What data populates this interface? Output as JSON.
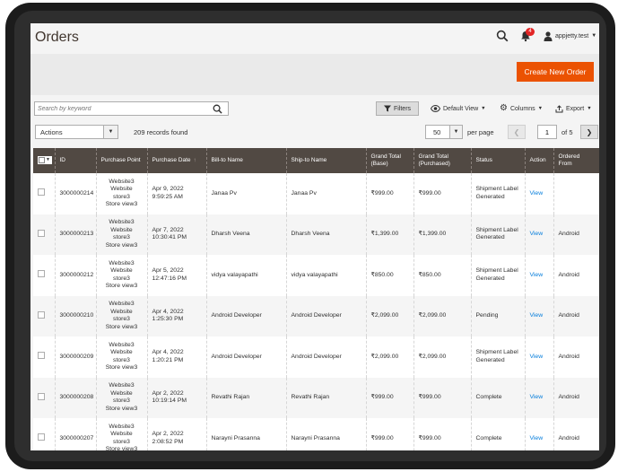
{
  "header": {
    "title": "Orders",
    "user_name": "appjetty.test",
    "notification_count": "4"
  },
  "actions": {
    "create_label": "Create New Order"
  },
  "toolbar": {
    "search_placeholder": "Search by keyword",
    "filters_label": "Filters",
    "default_view_label": "Default View",
    "columns_label": "Columns",
    "export_label": "Export",
    "mass_action_label": "Actions",
    "records_found": "209 records found",
    "per_page_value": "50",
    "per_page_label": "per page",
    "current_page": "1",
    "total_pages_label": "of 5"
  },
  "table": {
    "columns": [
      "ID",
      "Purchase Point",
      "Purchase Date",
      "Bill-to Name",
      "Ship-to Name",
      "Grand Total (Base)",
      "Grand Total (Purchased)",
      "Status",
      "Action",
      "Ordered From"
    ],
    "purchase_point_lines": [
      "Website3",
      "Website",
      "store3",
      "Store view3"
    ],
    "rows": [
      {
        "id": "3000000214",
        "date": "Apr 9, 2022 9:59:25 AM",
        "bill_to": "Janaa Pv",
        "ship_to": "Janaa Pv",
        "total_base": "₹999.00",
        "total_purchased": "₹999.00",
        "status": "Shipment Label Generated",
        "action": "View",
        "ordered_from": ""
      },
      {
        "id": "3000000213",
        "date": "Apr 7, 2022 10:30:41 PM",
        "bill_to": "Dharsh Veena",
        "ship_to": "Dharsh Veena",
        "total_base": "₹1,399.00",
        "total_purchased": "₹1,399.00",
        "status": "Shipment Label Generated",
        "action": "View",
        "ordered_from": "Android"
      },
      {
        "id": "3000000212",
        "date": "Apr 5, 2022 12:47:16 PM",
        "bill_to": "vidya valayapathi",
        "ship_to": "vidya valayapathi",
        "total_base": "₹850.00",
        "total_purchased": "₹850.00",
        "status": "Shipment Label Generated",
        "action": "View",
        "ordered_from": "Android"
      },
      {
        "id": "3000000210",
        "date": "Apr 4, 2022 1:25:30 PM",
        "bill_to": "Android Developer",
        "ship_to": "Android Developer",
        "total_base": "₹2,099.00",
        "total_purchased": "₹2,099.00",
        "status": "Pending",
        "action": "View",
        "ordered_from": "Android"
      },
      {
        "id": "3000000209",
        "date": "Apr 4, 2022 1:20:21 PM",
        "bill_to": "Android Developer",
        "ship_to": "Android Developer",
        "total_base": "₹2,099.00",
        "total_purchased": "₹2,099.00",
        "status": "Shipment Label Generated",
        "action": "View",
        "ordered_from": "Android"
      },
      {
        "id": "3000000208",
        "date": "Apr 2, 2022 10:19:14 PM",
        "bill_to": "Revathi Rajan",
        "ship_to": "Revathi Rajan",
        "total_base": "₹999.00",
        "total_purchased": "₹999.00",
        "status": "Complete",
        "action": "View",
        "ordered_from": "Android"
      },
      {
        "id": "3000000207",
        "date": "Apr 2, 2022 2:08:52 PM",
        "bill_to": "Narayni Prasanna",
        "ship_to": "Narayni Prasanna",
        "total_base": "₹999.00",
        "total_purchased": "₹999.00",
        "status": "Complete",
        "action": "View",
        "ordered_from": "Android"
      }
    ]
  },
  "colors": {
    "accent": "#eb5202",
    "header_bg": "#514943",
    "link": "#007bdb"
  }
}
